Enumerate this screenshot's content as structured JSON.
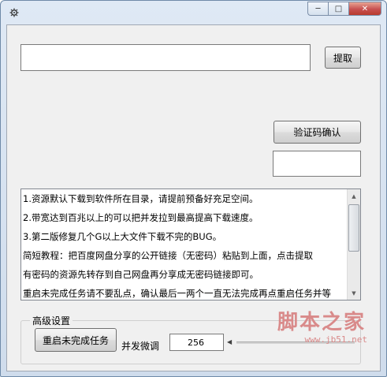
{
  "window": {
    "app_icon": "gear-app-icon",
    "controls": {
      "minimize": "─",
      "maximize": "□",
      "close": "✕"
    }
  },
  "main": {
    "url_input": {
      "value": "",
      "placeholder": ""
    },
    "fetch_button": "提取",
    "captcha_button": "验证码确认",
    "captcha_input": {
      "value": ""
    }
  },
  "info": {
    "lines": [
      "1.资源默认下载到软件所在目录，请提前预备好充足空间。",
      "2.带宽达到百兆以上的可以把并发拉到最高提高下载速度。",
      "3.第二版修复几个G以上大文件下载不完的BUG。",
      "简短教程：把百度网盘分享的公开链接（无密码）粘贴到上面，点击提取",
      "有密码的资源先转存到自己网盘再分享成无密码链接即可。",
      "重启未完成任务请不要乱点，确认最后一两个一直无法完成再点重启任务并等"
    ]
  },
  "advanced": {
    "group_label": "高级设置",
    "restart_button": "重启未完成任务",
    "concurrency_label": "并发微调",
    "concurrency_value": "256"
  },
  "watermark": {
    "title": "脚本之家",
    "url": "www.jb51.net"
  }
}
